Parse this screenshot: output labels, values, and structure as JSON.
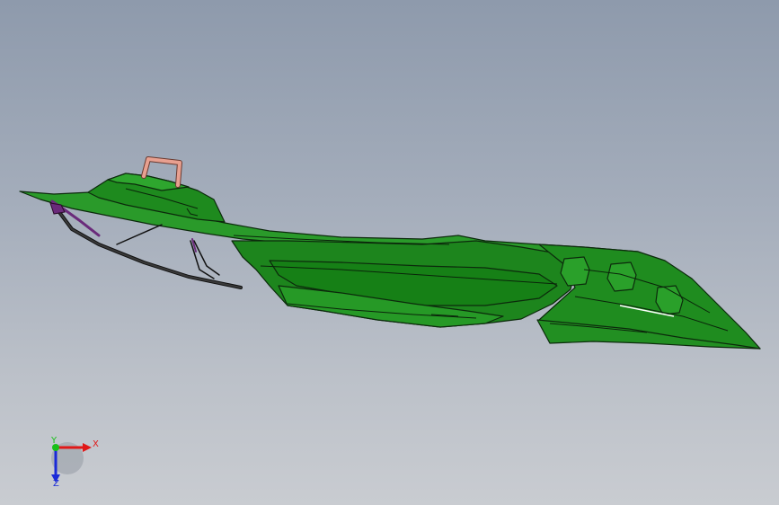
{
  "triad": {
    "x_label": "X",
    "y_label": "Y",
    "z_label": "Z",
    "colors": {
      "x": "#e01818",
      "y": "#18c018",
      "z": "#1a2ad8"
    }
  },
  "model": {
    "part_color": "#1f8a1f",
    "edge_color": "#0c2a0c",
    "handle_color": "#e8a090",
    "bracket_color": "#6a2a7a"
  }
}
